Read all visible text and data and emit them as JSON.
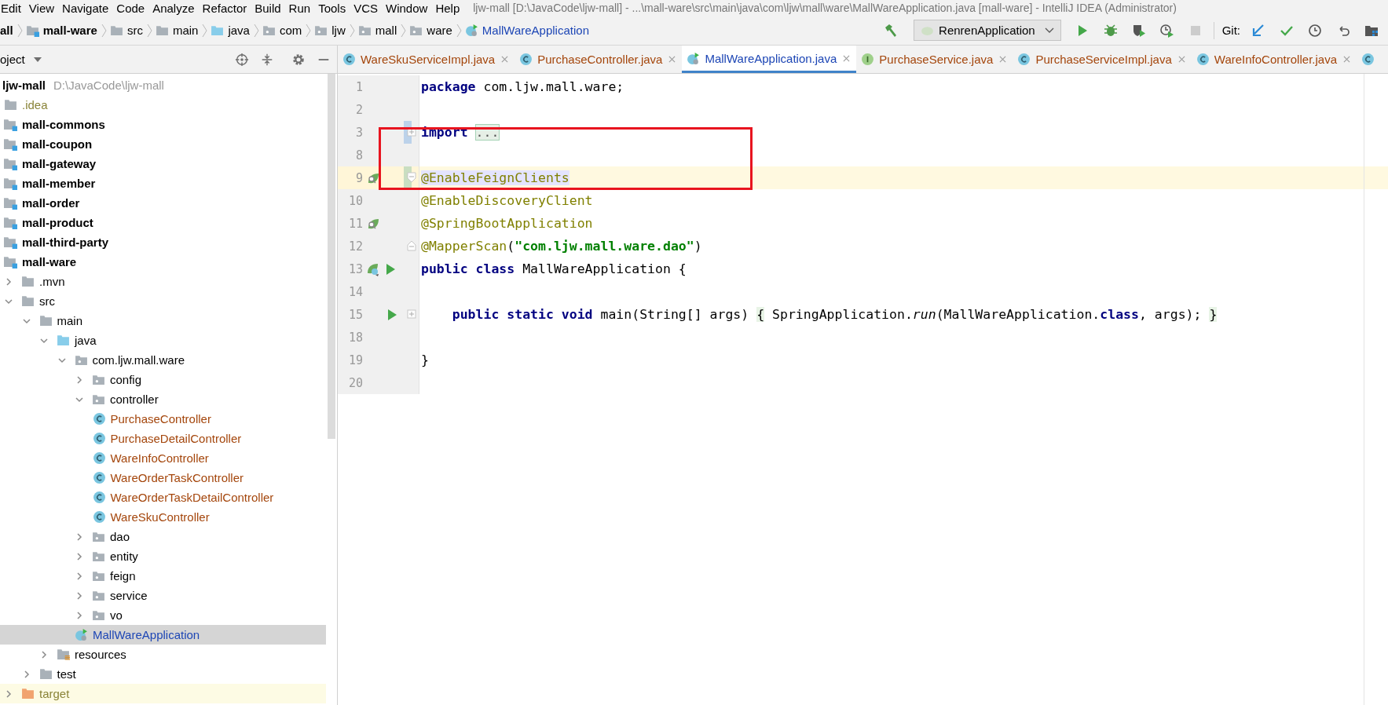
{
  "menu": [
    "Edit",
    "View",
    "Navigate",
    "Code",
    "Analyze",
    "Refactor",
    "Build",
    "Run",
    "Tools",
    "VCS",
    "Window",
    "Help"
  ],
  "window": {
    "title": "ljw-mall [D:\\JavaCode\\ljw-mall] - ...\\mall-ware\\src\\main\\java\\com\\ljw\\mall\\ware\\MallWareApplication.java [mall-ware] - IntelliJ IDEA (Administrator)"
  },
  "breadcrumbs": [
    {
      "label": "all",
      "kind": "text"
    },
    {
      "label": "mall-ware",
      "kind": "module"
    },
    {
      "label": "src",
      "kind": "folder"
    },
    {
      "label": "main",
      "kind": "folder"
    },
    {
      "label": "java",
      "kind": "source"
    },
    {
      "label": "com",
      "kind": "package"
    },
    {
      "label": "ljw",
      "kind": "package"
    },
    {
      "label": "mall",
      "kind": "package"
    },
    {
      "label": "ware",
      "kind": "package"
    },
    {
      "label": "MallWareApplication",
      "kind": "app"
    }
  ],
  "toolbar_left": [
    {
      "kind": "build",
      "disabled": false
    }
  ],
  "run_config": {
    "label": "RenrenApplication"
  },
  "toolbar": [
    {
      "kind": "run",
      "disabled": false
    },
    {
      "kind": "debug",
      "disabled": false
    },
    {
      "kind": "coverage",
      "disabled": false
    },
    {
      "kind": "profile",
      "disabled": false
    },
    {
      "kind": "stop",
      "disabled": true
    }
  ],
  "vcs": {
    "label": "Git:",
    "actions": [
      {
        "kind": "update",
        "disabled": false
      },
      {
        "kind": "commit",
        "disabled": false
      },
      {
        "kind": "history",
        "disabled": false
      },
      {
        "kind": "rollback",
        "disabled": false
      },
      {
        "kind": "structure",
        "disabled": false
      }
    ]
  },
  "project_panel": {
    "title": "oject"
  },
  "tabs": [
    {
      "label": "WareSkuServiceImpl.java",
      "kind": "class",
      "color": "#a4460c",
      "selected": false
    },
    {
      "label": "PurchaseController.java",
      "kind": "class",
      "color": "#a4460c",
      "selected": false
    },
    {
      "label": "MallWareApplication.java",
      "kind": "app",
      "color": "#1d46b5",
      "selected": true
    },
    {
      "label": "PurchaseService.java",
      "kind": "interface",
      "color": "#a4460c",
      "selected": false
    },
    {
      "label": "PurchaseServiceImpl.java",
      "kind": "class",
      "color": "#a4460c",
      "selected": false
    },
    {
      "label": "WareInfoController.java",
      "kind": "class",
      "color": "#a4460c",
      "selected": false
    },
    {
      "kind": "class",
      "selected": false
    }
  ],
  "project": {
    "name": "ljw-mall",
    "path": "D:\\JavaCode\\ljw-mall"
  },
  "tree": [
    {
      "label": ".idea",
      "kind": "folder",
      "color": "#8a8438",
      "selected": false
    },
    {
      "label": "mall-commons",
      "kind": "module",
      "selected": false
    },
    {
      "label": "mall-coupon",
      "kind": "module",
      "selected": false
    },
    {
      "label": "mall-gateway",
      "kind": "module",
      "selected": false
    },
    {
      "label": "mall-member",
      "kind": "module",
      "selected": false
    },
    {
      "label": "mall-order",
      "kind": "module",
      "selected": false
    },
    {
      "label": "mall-product",
      "kind": "module",
      "selected": false
    },
    {
      "label": "mall-third-party",
      "kind": "module",
      "selected": false
    },
    {
      "label": "mall-ware",
      "kind": "module",
      "selected": false,
      "children": [
        {
          "label": ".mvn",
          "kind": "folder",
          "expanded": false,
          "selected": false
        },
        {
          "label": "src",
          "kind": "folder",
          "expanded": true,
          "selected": false,
          "children": [
            {
              "label": "main",
              "kind": "folder",
              "expanded": true,
              "selected": false,
              "children": [
                {
                  "label": "java",
                  "kind": "source",
                  "expanded": true,
                  "selected": false,
                  "children": [
                    {
                      "label": "com.ljw.mall.ware",
                      "kind": "package",
                      "expanded": true,
                      "selected": false,
                      "children": [
                        {
                          "label": "config",
                          "kind": "package",
                          "expanded": false,
                          "selected": false
                        },
                        {
                          "label": "controller",
                          "kind": "package",
                          "expanded": true,
                          "selected": false,
                          "children": [
                            {
                              "label": "PurchaseController",
                              "kind": "class",
                              "color": "#a4460c",
                              "selected": false
                            },
                            {
                              "label": "PurchaseDetailController",
                              "kind": "class",
                              "color": "#a4460c",
                              "selected": false
                            },
                            {
                              "label": "WareInfoController",
                              "kind": "class",
                              "color": "#a4460c",
                              "selected": false
                            },
                            {
                              "label": "WareOrderTaskController",
                              "kind": "class",
                              "color": "#a4460c",
                              "selected": false
                            },
                            {
                              "label": "WareOrderTaskDetailController",
                              "kind": "class",
                              "color": "#a4460c",
                              "selected": false
                            },
                            {
                              "label": "WareSkuController",
                              "kind": "class",
                              "color": "#a4460c",
                              "selected": false
                            }
                          ]
                        },
                        {
                          "label": "dao",
                          "kind": "package",
                          "expanded": false,
                          "selected": false
                        },
                        {
                          "label": "entity",
                          "kind": "package",
                          "expanded": false,
                          "selected": false
                        },
                        {
                          "label": "feign",
                          "kind": "package",
                          "expanded": false,
                          "selected": false
                        },
                        {
                          "label": "service",
                          "kind": "package",
                          "expanded": false,
                          "selected": false
                        },
                        {
                          "label": "vo",
                          "kind": "package",
                          "expanded": false,
                          "selected": false
                        },
                        {
                          "label": "MallWareApplication",
                          "kind": "app",
                          "color": "#1d46b5",
                          "selected": true
                        }
                      ]
                    }
                  ]
                },
                {
                  "label": "resources",
                  "kind": "resources",
                  "expanded": false,
                  "selected": false
                }
              ]
            },
            {
              "label": "test",
              "kind": "folder",
              "expanded": false,
              "selected": false
            }
          ]
        },
        {
          "label": "target",
          "kind": "excluded",
          "color": "#8a8438",
          "expanded": false,
          "selected": false
        }
      ]
    }
  ],
  "code": [
    {
      "number": "1",
      "tokens": [
        {
          "text": "package",
          "kind": "kw"
        },
        {
          "text": " com.ljw.mall.ware;",
          "kind": "plain"
        }
      ]
    },
    {
      "number": "2"
    },
    {
      "number": "3",
      "change_marker": {
        "kind": "modified"
      },
      "fold_marker": {
        "kind": "expand"
      },
      "tokens": [
        {
          "text": "import",
          "kind": "kw"
        },
        {
          "text": "...",
          "kind": "folded"
        }
      ]
    },
    {
      "number": "8"
    },
    {
      "number": "9",
      "current": true,
      "change_marker": {
        "kind": "added"
      },
      "fold_marker": {
        "kind": "start"
      },
      "gutter": [
        {
          "kind": "bean"
        }
      ],
      "tokens": [
        {
          "text": "@EnableFeignClients",
          "kind": "ann-hl"
        }
      ]
    },
    {
      "number": "10",
      "tokens": [
        {
          "text": "@EnableDiscoveryClient",
          "kind": "ann"
        }
      ]
    },
    {
      "number": "11",
      "gutter": [
        {
          "kind": "bean"
        }
      ],
      "tokens": [
        {
          "text": "@SpringBootApplication",
          "kind": "ann"
        }
      ]
    },
    {
      "number": "12",
      "fold_marker": {
        "kind": "end"
      },
      "tokens": [
        {
          "text": "@MapperScan",
          "kind": "ann"
        },
        {
          "text": "(",
          "kind": "plain"
        },
        {
          "text": "\"com.ljw.mall.ware.dao\"",
          "kind": "str"
        },
        {
          "text": ")",
          "kind": "plain"
        }
      ]
    },
    {
      "number": "13",
      "gutter": [
        {
          "kind": "bean-run"
        },
        {
          "kind": "run"
        }
      ],
      "tokens": [
        {
          "text": "public class",
          "kind": "kw"
        },
        {
          "text": " MallWareApplication {",
          "kind": "plain"
        }
      ]
    },
    {
      "number": "14"
    },
    {
      "number": "15",
      "fold_marker": {
        "kind": "expand"
      },
      "gutter": [
        {
          "kind": "run"
        }
      ],
      "tokens": [
        {
          "text": "    public static void",
          "kind": "kw"
        },
        {
          "text": " main(String[] args) ",
          "kind": "plain"
        },
        {
          "text": "{",
          "kind": "folded-brace"
        },
        {
          "text": " SpringApplication.",
          "kind": "plain"
        },
        {
          "text": "run",
          "kind": "italic"
        },
        {
          "text": "(MallWareApplication.",
          "kind": "plain"
        },
        {
          "text": "class",
          "kind": "kw"
        },
        {
          "text": ", args); ",
          "kind": "plain"
        },
        {
          "text": "}",
          "kind": "folded-brace"
        }
      ]
    },
    {
      "number": "18"
    },
    {
      "number": "19",
      "tokens": [
        {
          "text": "}",
          "kind": "plain"
        }
      ]
    },
    {
      "number": "20"
    }
  ]
}
